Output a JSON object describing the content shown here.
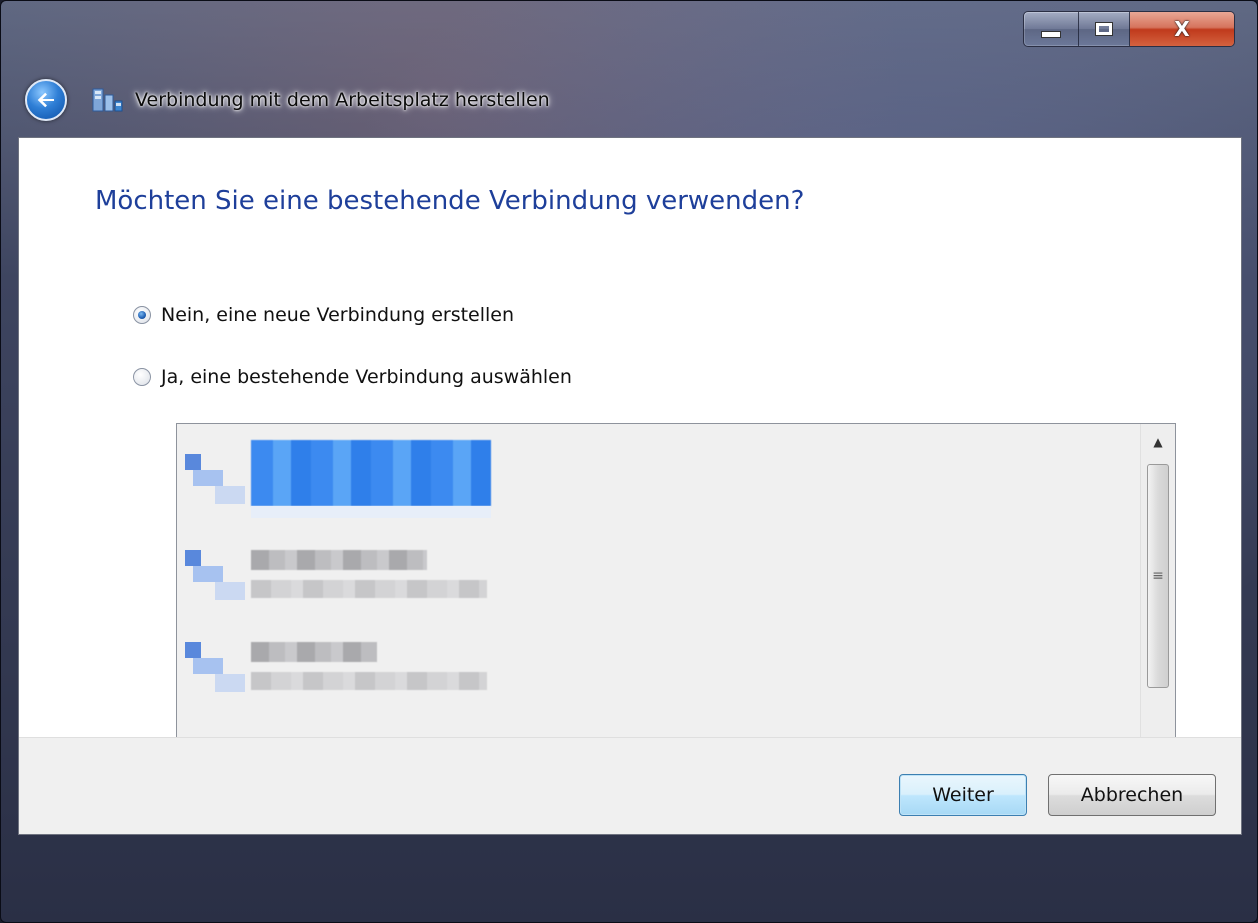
{
  "window": {
    "title": "Verbindung mit dem Arbeitsplatz herstellen",
    "caption": {
      "minimize": "—",
      "maximize": "☐",
      "close": "X"
    }
  },
  "page": {
    "heading": "Möchten Sie eine bestehende Verbindung verwenden?"
  },
  "options": [
    {
      "label": "Nein, eine neue Verbindung erstellen",
      "selected": true
    },
    {
      "label": "Ja, eine bestehende Verbindung auswählen",
      "selected": false
    }
  ],
  "connections": {
    "items": [
      {
        "name": "",
        "selected": true
      },
      {
        "name": "",
        "selected": false
      },
      {
        "name": "",
        "selected": false
      },
      {
        "name": "",
        "selected": false
      }
    ],
    "scrollbar": {
      "up": "▲",
      "down": "▼",
      "grip": "≡"
    }
  },
  "footer": {
    "next_label": "Weiter",
    "cancel_label": "Abbrechen"
  },
  "colors": {
    "heading": "#1e3f9a",
    "selection": "#3c8af0",
    "default_button_border": "#3c7fb1"
  }
}
